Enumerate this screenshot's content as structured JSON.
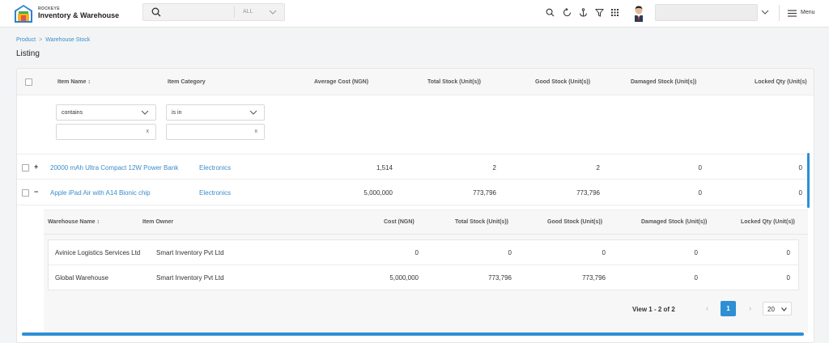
{
  "app": {
    "brand_small": "ROCKEYE",
    "brand_name": "Inventory & Warehouse"
  },
  "search": {
    "placeholder": "",
    "scope": "ALL"
  },
  "topnav": {
    "icons": [
      "search-icon",
      "refresh-icon",
      "anchor-icon",
      "funnel-icon",
      "apps-grid-icon"
    ],
    "menu_label": "Menu"
  },
  "breadcrumb": {
    "items": [
      "Product",
      "Warehouse Stock"
    ],
    "separator": ">"
  },
  "page": {
    "title": "Listing"
  },
  "table": {
    "columns": [
      "Item Name",
      "Item Category",
      "Average Cost (NGN)",
      "Total Stock (Unit(s))",
      "Good Stock (Unit(s))",
      "Damaged Stock (Unit(s))",
      "Locked Qty (Unit(s)"
    ],
    "sort_icon": "↕",
    "filters": {
      "name_operator": "contains",
      "category_operator": "is in",
      "clear": "x"
    },
    "rows": [
      {
        "toggle": "+",
        "name": "20000 mAh Ultra Compact 12W Power Bank",
        "category": "Electronics",
        "avg_cost": "1,514",
        "total": "2",
        "good": "2",
        "damaged": "0",
        "locked": "0"
      },
      {
        "toggle": "−",
        "name": "Apple iPad Air with A14 Bionic chip",
        "category": "Electronics",
        "avg_cost": "5,000,000",
        "total": "773,796",
        "good": "773,796",
        "damaged": "0",
        "locked": "0"
      }
    ]
  },
  "subtable": {
    "columns": [
      "Warehouse Name",
      "Item Owner",
      "Cost (NGN)",
      "Total Stock (Unit(s))",
      "Good Stock (Unit(s))",
      "Damaged Stock (Unit(s))",
      "Locked Qty (Unit(s))"
    ],
    "rows": [
      {
        "warehouse": "Avinice Logistics Services Ltd",
        "owner": "Smart Inventory Pvt Ltd",
        "cost": "0",
        "total": "0",
        "good": "0",
        "damaged": "0",
        "locked": "0"
      },
      {
        "warehouse": "Global Warehouse",
        "owner": "Smart Inventory Pvt Ltd",
        "cost": "5,000,000",
        "total": "773,796",
        "good": "773,796",
        "damaged": "0",
        "locked": "0"
      }
    ]
  },
  "pagination": {
    "summary": "View 1 - 2 of 2",
    "prev": "‹",
    "current_page": "1",
    "next": "›",
    "page_size": "20"
  },
  "colors": {
    "accent": "#2e8fd4",
    "link": "#3a8cc9"
  }
}
